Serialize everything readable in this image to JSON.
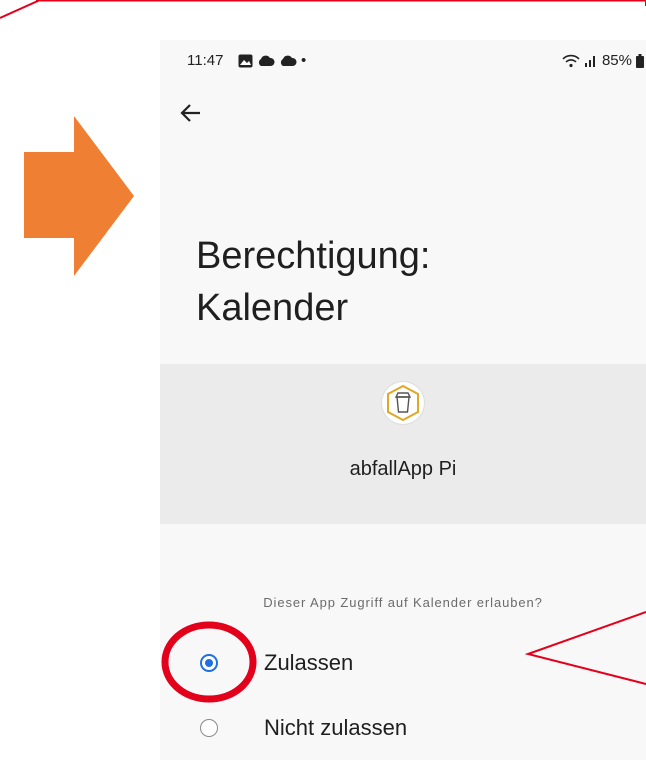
{
  "status_bar": {
    "time": "11:47",
    "dot": "•",
    "battery": "85%",
    "icons": [
      "gallery-icon",
      "cloud-icon",
      "cloud-icon",
      "wifi-icon",
      "signal-icon",
      "battery-icon"
    ]
  },
  "permission": {
    "title_line1": "Berechtigung:",
    "title_line2": "Kalender"
  },
  "app": {
    "name": "abfallApp Pi",
    "icon": "trash-bin-icon"
  },
  "question": "Dieser App Zugriff auf Kalender erlauben?",
  "options": [
    {
      "label": "Zulassen",
      "selected": true
    },
    {
      "label": "Nicht zulassen",
      "selected": false
    }
  ],
  "colors": {
    "accent": "#1f6fe0",
    "annotation_red": "#e3001b",
    "arrow_orange": "#ef7f33",
    "app_icon_gold": "#e0a825"
  }
}
